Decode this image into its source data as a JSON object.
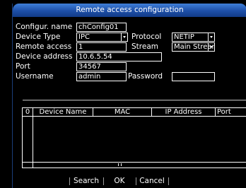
{
  "dialog": {
    "title": "Remote access configuration"
  },
  "form": {
    "config_name_label": "Configur. name",
    "config_name_value": "chConfig01",
    "device_type_label": "Device Type",
    "device_type_value": "IPC",
    "protocol_label": "Protocol",
    "protocol_value": "NETIP",
    "remote_access_label": "Remote access",
    "remote_access_value": "1",
    "stream_label": "Stream",
    "stream_value": "Main Stream",
    "device_address_label": "Device address",
    "device_address_value": "10.6.5.54",
    "port_label": "Port",
    "port_value": "34567",
    "username_label": "Username",
    "username_value": "admin",
    "password_label": "Password",
    "password_value": ""
  },
  "table": {
    "columns": [
      "0",
      "Device Name",
      "MAC",
      "IP Address",
      "Port"
    ],
    "rows": []
  },
  "buttons": {
    "search": "Search",
    "ok": "OK",
    "cancel": "Cancel"
  },
  "icons": {
    "dropdown": "chevron-down-icon"
  },
  "colors": {
    "title_bar": "#1d4fa8",
    "background": "#000000",
    "text": "#ffffff"
  }
}
